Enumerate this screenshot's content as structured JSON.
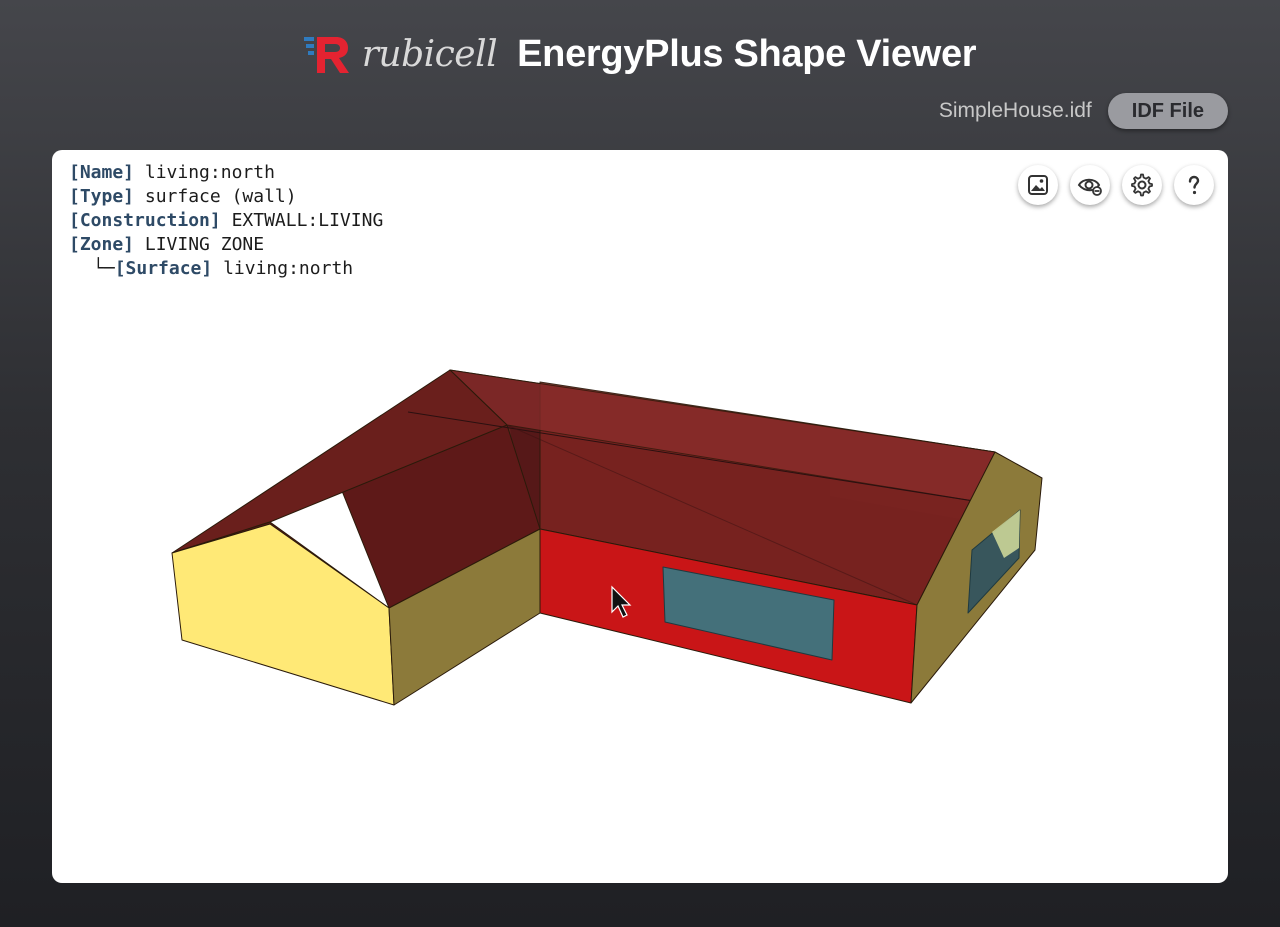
{
  "header": {
    "brand": "rubicell",
    "title": "EnergyPlus Shape Viewer"
  },
  "file": {
    "name": "SimpleHouse.idf",
    "button_label": "IDF File"
  },
  "info": {
    "name_key": "[Name]",
    "name_value": "living:north",
    "type_key": "[Type]",
    "type_value": "surface (wall)",
    "construction_key": "[Construction]",
    "construction_value": "EXTWALL:LIVING",
    "zone_key": "[Zone]",
    "zone_value": "LIVING ZONE",
    "tree_prefix": "└─",
    "surface_key": "[Surface]",
    "surface_value": "living:north"
  },
  "toolbar": [
    {
      "icon": "image-icon",
      "action": "screenshot"
    },
    {
      "icon": "eye-icon",
      "action": "visibility"
    },
    {
      "icon": "gear-icon",
      "action": "settings"
    },
    {
      "icon": "help-icon",
      "action": "help"
    }
  ],
  "colors": {
    "brand_red": "#e42331",
    "brand_blue": "#2f7bbf",
    "selected_wall": "#c91517",
    "wall_lit": "#ffe976",
    "wall_shaded": "#8c7a3a",
    "roof": "#6e1c1a",
    "window": "#44707a"
  }
}
